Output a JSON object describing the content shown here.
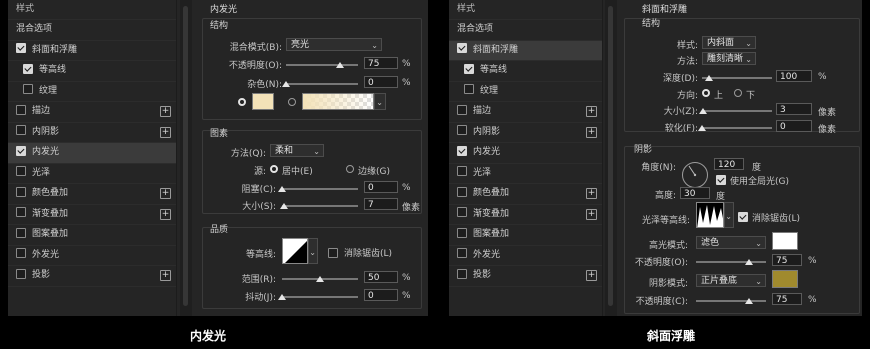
{
  "left": {
    "styles_header": "样式",
    "blend_options": "混合选项",
    "items": [
      {
        "label": "斜面和浮雕",
        "checked": true
      },
      {
        "label": "等高线",
        "checked": true
      },
      {
        "label": "纹理",
        "checked": false
      },
      {
        "label": "描边",
        "checked": false
      },
      {
        "label": "内阴影",
        "checked": false
      },
      {
        "label": "内发光",
        "checked": true
      },
      {
        "label": "光泽",
        "checked": false
      },
      {
        "label": "颜色叠加",
        "checked": false
      },
      {
        "label": "渐变叠加",
        "checked": false
      },
      {
        "label": "图案叠加",
        "checked": false
      },
      {
        "label": "外发光",
        "checked": false
      },
      {
        "label": "投影",
        "checked": false
      }
    ],
    "panel_title": "内发光",
    "structure": {
      "title": "结构",
      "blend_mode_label": "混合模式(B):",
      "blend_mode_value": "亮光",
      "opacity_label": "不透明度(O):",
      "opacity_value": "75",
      "opacity_level": 0.75,
      "noise_label": "杂色(N):",
      "noise_value": "0",
      "noise_level": 0,
      "percent": "%",
      "chevron": "⌄"
    },
    "elements": {
      "title": "图素",
      "method_label": "方法(Q):",
      "method_value": "柔和",
      "source_label": "源:",
      "center_label": "居中(E)",
      "edge_label": "边缘(G)",
      "choke_label": "阻塞(C):",
      "choke_value": "0",
      "choke_level": 0,
      "size_label": "大小(S):",
      "size_value": "7",
      "size_level": 0.03,
      "px_unit": "像素"
    },
    "quality": {
      "title": "品质",
      "contour_label": "等高线:",
      "antialias_label": "消除锯齿(L)",
      "range_label": "范围(R):",
      "range_value": "50",
      "range_level": 0.5,
      "jitter_label": "抖动(J):",
      "jitter_value": "0",
      "jitter_level": 0
    },
    "glow_color": "#f3e2b8",
    "caption": "内发光"
  },
  "right": {
    "styles_header": "样式",
    "blend_options": "混合选项",
    "items": [
      {
        "label": "斜面和浮雕",
        "checked": true
      },
      {
        "label": "等高线",
        "checked": true
      },
      {
        "label": "纹理",
        "checked": false
      },
      {
        "label": "描边",
        "checked": false
      },
      {
        "label": "内阴影",
        "checked": false
      },
      {
        "label": "内发光",
        "checked": true
      },
      {
        "label": "光泽",
        "checked": false
      },
      {
        "label": "颜色叠加",
        "checked": false
      },
      {
        "label": "渐变叠加",
        "checked": false
      },
      {
        "label": "图案叠加",
        "checked": false
      },
      {
        "label": "外发光",
        "checked": false
      },
      {
        "label": "投影",
        "checked": false
      }
    ],
    "panel_title": "斜面和浮雕",
    "structure": {
      "title": "结构",
      "style_label": "样式:",
      "style_value": "内斜面",
      "technique_label": "方法:",
      "technique_value": "雕刻清晰",
      "depth_label": "深度(D):",
      "depth_value": "100",
      "depth_level": 0.1,
      "direction_label": "方向:",
      "up_label": "上",
      "down_label": "下",
      "size_label": "大小(Z):",
      "size_value": "3",
      "size_level": 0.02,
      "soften_label": "软化(F):",
      "soften_value": "0",
      "soften_level": 0,
      "percent": "%",
      "px_unit": "像素"
    },
    "shading": {
      "title": "阴影",
      "angle_label": "角度(N):",
      "angle_value": "120",
      "degree": "度",
      "global_light_label": "使用全局光(G)",
      "altitude_label": "高度:",
      "altitude_value": "30",
      "gloss_label": "光泽等高线:",
      "antialias_label": "消除锯齿(L)",
      "highlight_label": "高光模式:",
      "highlight_value": "滤色",
      "highlight_color": "#ffffff",
      "hl_opacity_label": "不透明度(O):",
      "hl_opacity_value": "75",
      "hl_opacity_level": 0.75,
      "shadow_label": "阴影模式:",
      "shadow_value": "正片叠底",
      "shadow_color": "#a08a2e",
      "sh_opacity_label": "不透明度(C):",
      "sh_opacity_value": "75",
      "sh_opacity_level": 0.75
    },
    "caption": "斜面浮雕"
  }
}
